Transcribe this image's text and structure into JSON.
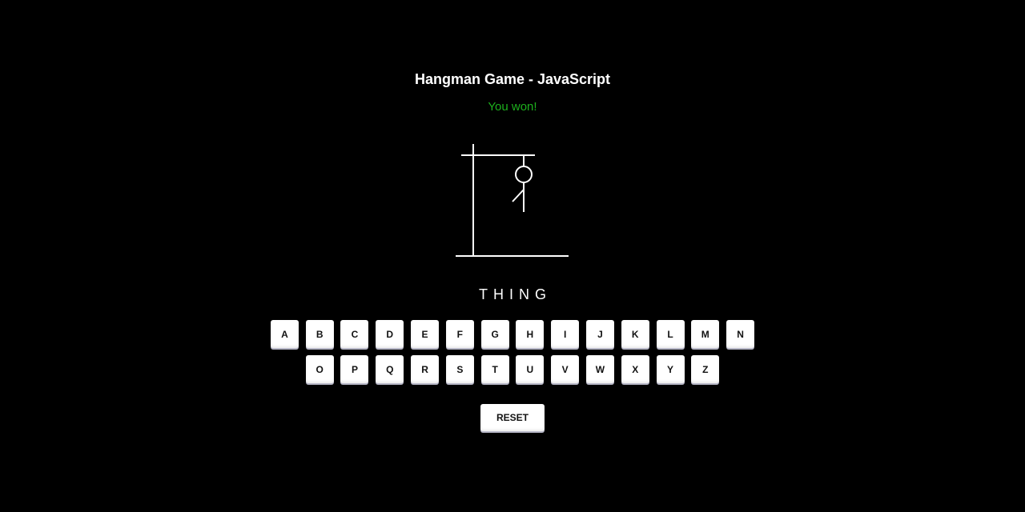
{
  "game": {
    "title": "Hangman Game - JavaScript",
    "status": "You won!",
    "status_color": "#1db01d",
    "word_display": "THING",
    "drawn_parts": [
      "gallows-base",
      "gallows-pole",
      "gallows-beam",
      "rope",
      "head",
      "body",
      "left-arm"
    ]
  },
  "keyboard": {
    "row1": [
      "A",
      "B",
      "C",
      "D",
      "E",
      "F",
      "G",
      "H",
      "I",
      "J",
      "K",
      "L",
      "M",
      "N"
    ],
    "row2": [
      "O",
      "P",
      "Q",
      "R",
      "S",
      "T",
      "U",
      "V",
      "W",
      "X",
      "Y",
      "Z"
    ]
  },
  "controls": {
    "reset_label": "RESET"
  },
  "colors": {
    "background": "#000000",
    "foreground": "#ffffff",
    "key_background": "#ffffff",
    "key_text": "#111111"
  }
}
